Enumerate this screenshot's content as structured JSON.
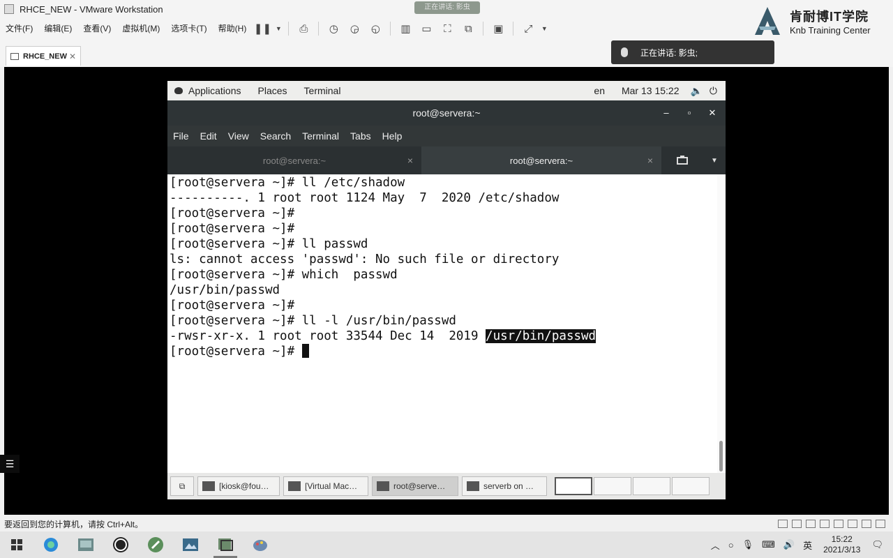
{
  "vmware": {
    "title": "RHCE_NEW - VMware Workstation",
    "menu": [
      "文件(F)",
      "编辑(E)",
      "查看(V)",
      "虚拟机(M)",
      "选项卡(T)",
      "帮助(H)"
    ],
    "top_overlay": "正在讲话: 影虫",
    "tab_label": "RHCE_NEW",
    "tab_close": "✕",
    "status_text": "要返回到您的计算机，请按 Ctrl+Alt。"
  },
  "brand": {
    "name_cn": "肯耐博IT学院",
    "name_en": "Knb Training Center"
  },
  "speaking": {
    "text": "正在讲话: 影虫;"
  },
  "gnome": {
    "applications": "Applications",
    "places": "Places",
    "terminal": "Terminal",
    "lang": "en",
    "datetime": "Mar 13  15:22"
  },
  "terminal_window": {
    "title": "root@servera:~",
    "minimize": "–",
    "maximize": "▫",
    "close": "✕",
    "menu": [
      "File",
      "Edit",
      "View",
      "Search",
      "Terminal",
      "Tabs",
      "Help"
    ],
    "tabs": [
      {
        "label": "root@servera:~",
        "active": false
      },
      {
        "label": "root@servera:~",
        "active": true
      }
    ],
    "tab_close": "×",
    "lines": [
      "[root@servera ~]# ll /etc/shadow",
      "----------. 1 root root 1124 May  7  2020 /etc/shadow",
      "[root@servera ~]#",
      "[root@servera ~]#",
      "[root@servera ~]# ll passwd",
      "ls: cannot access 'passwd': No such file or directory",
      "[root@servera ~]# which  passwd",
      "/usr/bin/passwd",
      "[root@servera ~]#",
      "[root@servera ~]# ll -l /usr/bin/passwd"
    ],
    "highlight_line_prefix": "-rwsr-xr-x. 1 root root 33544 Dec 14  2019 ",
    "highlight_line_selected": "/usr/bin/passwd",
    "prompt": "[root@servera ~]# "
  },
  "gnome_taskbar": [
    {
      "label": "[kiosk@fou…",
      "active": false
    },
    {
      "label": "[Virtual Mac…",
      "active": false
    },
    {
      "label": "root@serve…",
      "active": true
    },
    {
      "label": "serverb on …",
      "active": false
    }
  ],
  "windows_taskbar": {
    "ime": "英",
    "time": "15:22",
    "date": "2021/3/13"
  }
}
